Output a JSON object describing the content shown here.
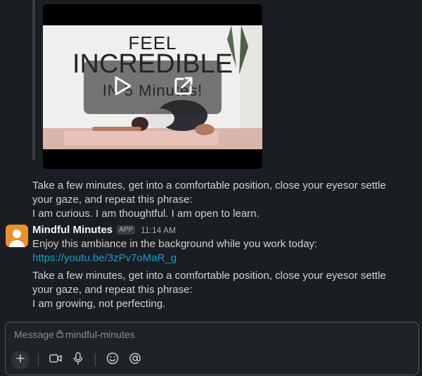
{
  "video": {
    "overlay_title_line1": "FEEL",
    "overlay_title_line2": "INCREDIBLE",
    "overlay_title_line3": "IN 5 Minutes!"
  },
  "previous_message": {
    "line": "Take a few minutes, get into a comfortable position, close your eyesor settle your gaze, and repeat this phrase:",
    "affirmation": "I am curious. I am thoughtful. I am open to learn."
  },
  "message": {
    "sender": "Mindful Minutes",
    "badge": "APP",
    "time": "11:14 AM",
    "text": "Enjoy this ambiance in the background while you work today:",
    "link": "https://youtu.be/3zPv7oMaR_g",
    "line": "Take a few minutes, get into a comfortable position, close your eyesor settle your gaze, and repeat this phrase:",
    "affirmation": "I am growing, not perfecting."
  },
  "composer": {
    "placeholder_prefix": "Message",
    "channel": "mindful-minutes"
  },
  "icons": {
    "play": "play-icon",
    "external": "external-link-icon",
    "plus": "plus-icon",
    "video": "video-camera-icon",
    "mic": "microphone-icon",
    "emoji": "emoji-icon",
    "mention": "at-mention-icon",
    "lock": "lock-icon"
  },
  "colors": {
    "background": "#1a1d21",
    "link": "#1d9bd1",
    "avatar": "#e8912d"
  }
}
